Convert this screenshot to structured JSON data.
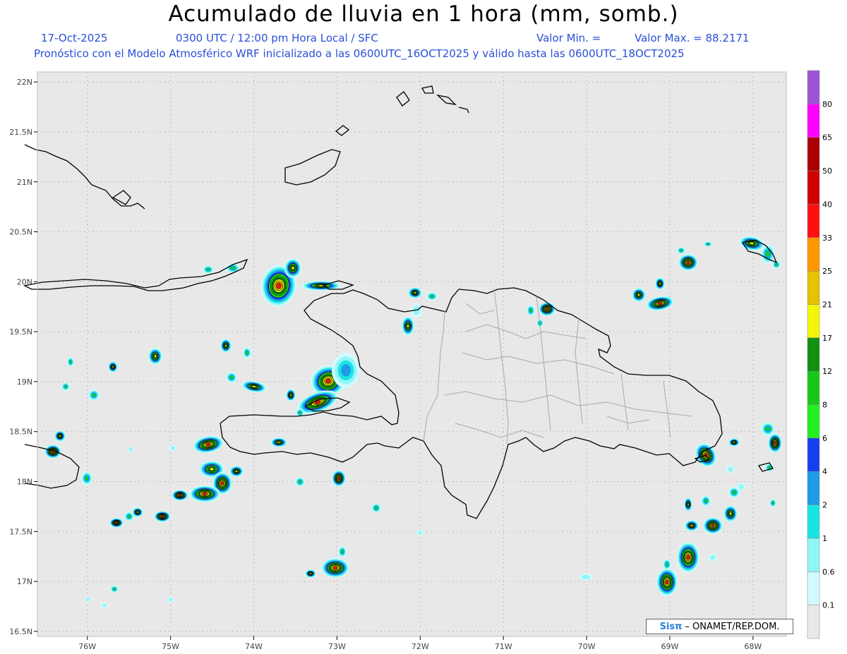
{
  "header": {
    "title": "Acumulado de lluvia en 1 hora (mm, somb.)",
    "date": "17-Oct-2025",
    "time": "0300 UTC / 12:00 pm Hora Local / SFC",
    "valor_min": "Valor Min. =",
    "valor_max": "Valor Max. = 88.2171",
    "model_line": "Pronóstico con el Modelo Atmosférico WRF inicializado a las 0600UTC_16OCT2025 y válido hasta las  0600UTC_18OCT2025"
  },
  "axes": {
    "lat_labels": [
      "22N",
      "21.5N",
      "21N",
      "20.5N",
      "20N",
      "19.5N",
      "19N",
      "18.5N",
      "18N",
      "17.5N",
      "17N",
      "16.5N"
    ],
    "lat_values": [
      22,
      21.5,
      21,
      20.5,
      20,
      19.5,
      19,
      18.5,
      18,
      17.5,
      17,
      16.5
    ],
    "lon_labels": [
      "76W",
      "75W",
      "74W",
      "73W",
      "72W",
      "71W",
      "70W",
      "69W",
      "68W"
    ],
    "lon_values": [
      -76,
      -75,
      -74,
      -73,
      -72,
      -71,
      -70,
      -69,
      -68
    ],
    "lat_range": [
      16.45,
      22.1
    ],
    "lon_range": [
      -76.6,
      -67.6
    ],
    "grid": "dotted"
  },
  "colorbar": {
    "labels": [
      "0.1",
      "0.6",
      "1",
      "2",
      "4",
      "6",
      "8",
      "12",
      "17",
      "21",
      "25",
      "33",
      "40",
      "50",
      "65",
      "80"
    ],
    "colors": [
      "#e8e8e8",
      "#d2fafc",
      "#8ff6f6",
      "#19e4e4",
      "#1e9ce8",
      "#1440f0",
      "#22f022",
      "#18c818",
      "#119011",
      "#f5f50a",
      "#e6c200",
      "#ff9600",
      "#ff1010",
      "#d20000",
      "#aa0000",
      "#ff00ff",
      "#9c54d6"
    ]
  },
  "credit": {
    "logo": "Sisπ",
    "text": "– ONAMET/REP.DOM."
  }
}
